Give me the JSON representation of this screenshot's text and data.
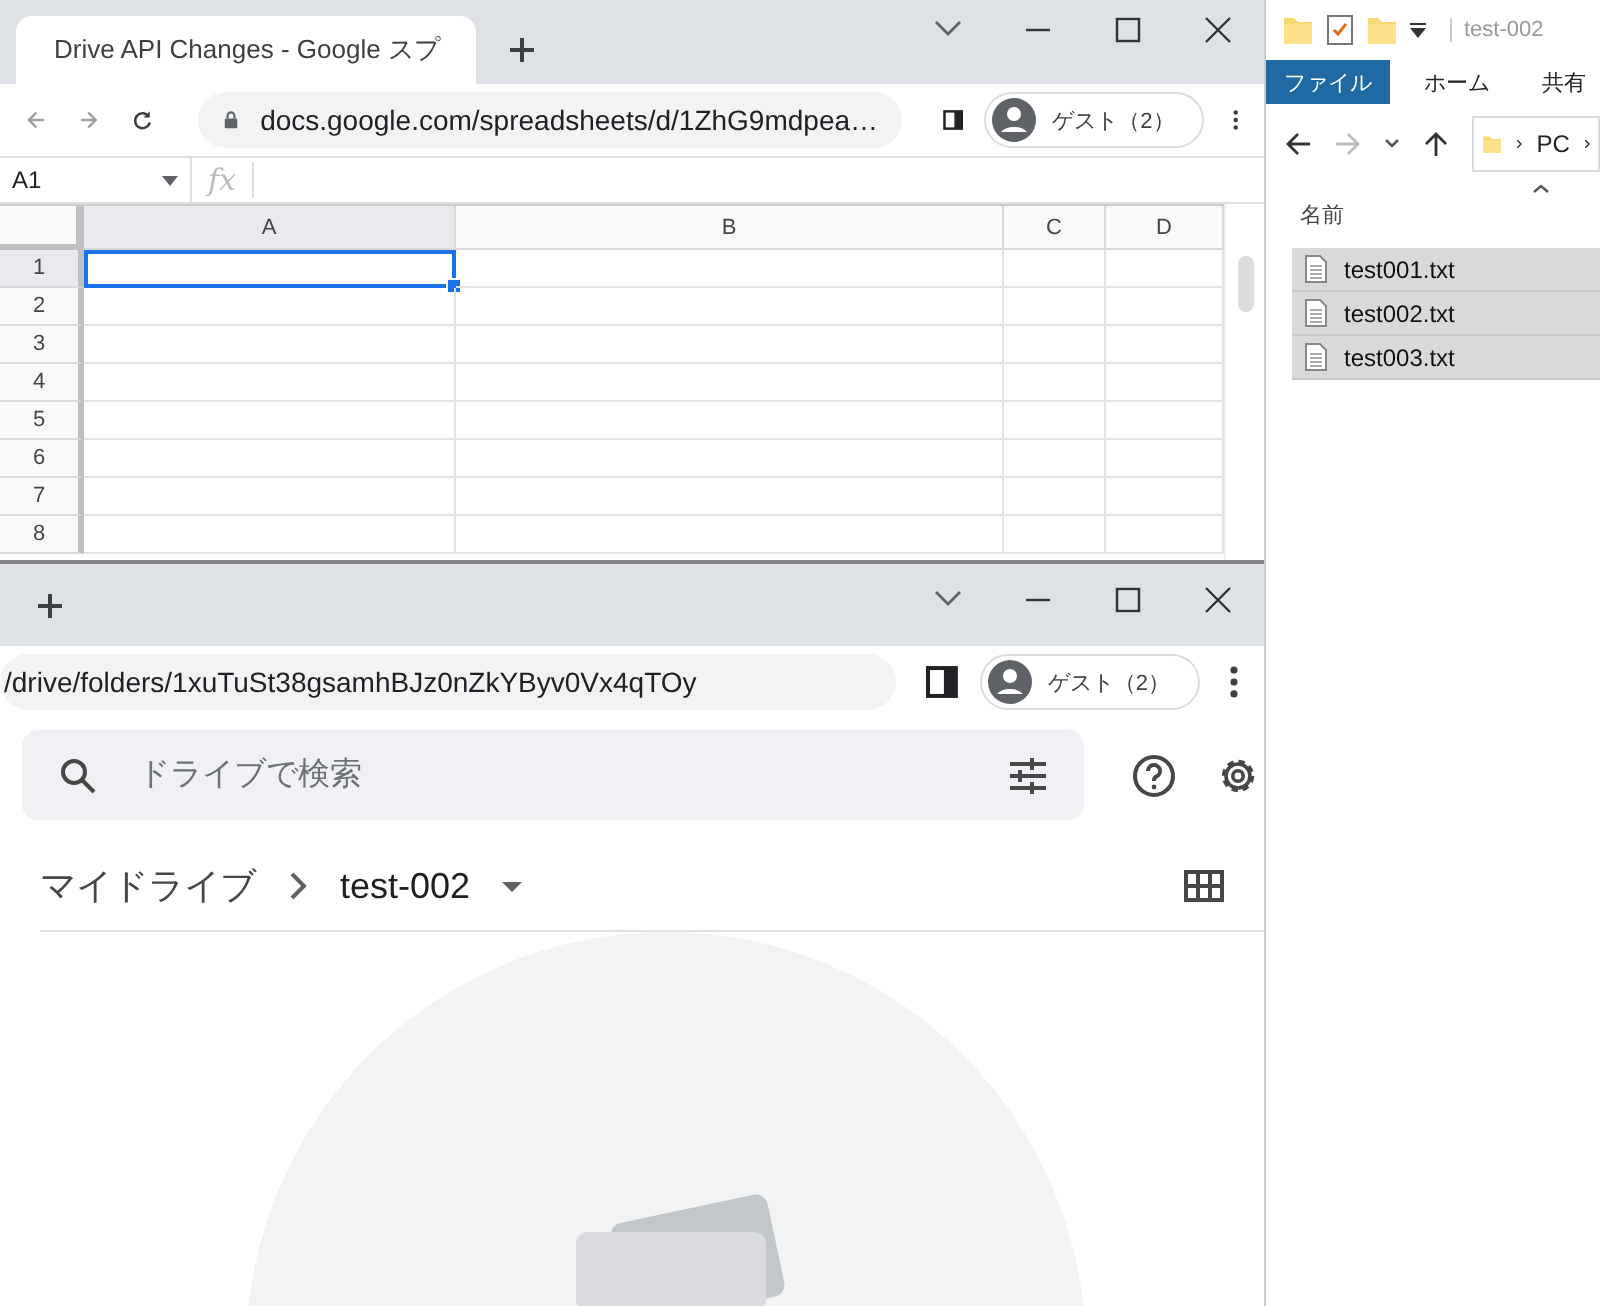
{
  "sheets_window": {
    "tab": {
      "title": "Drive API Changes - Google スプ",
      "selected": true
    },
    "address": "docs.google.com/spreadsheets/d/1ZhG9mdpea…",
    "profile": "ゲスト（2）",
    "name_box": "A1",
    "formula_label": "fx",
    "columns": [
      {
        "label": "A",
        "selected": true
      },
      {
        "label": "B",
        "selected": false
      },
      {
        "label": "C",
        "selected": false
      },
      {
        "label": "D",
        "selected": false
      }
    ],
    "rows": [
      {
        "label": "1",
        "selected": true
      },
      {
        "label": "2",
        "selected": false
      },
      {
        "label": "3",
        "selected": false
      },
      {
        "label": "4",
        "selected": false
      },
      {
        "label": "5",
        "selected": false
      },
      {
        "label": "6",
        "selected": false
      },
      {
        "label": "7",
        "selected": false
      },
      {
        "label": "8",
        "selected": false
      }
    ]
  },
  "drive_window": {
    "address": "/drive/folders/1xuTuSt38gsamhBJz0nZkYByv0Vx4qTOy",
    "profile": "ゲスト（2）",
    "search": {
      "placeholder": "ドライブで検索"
    },
    "breadcrumb": [
      "マイドライブ",
      "test-002"
    ]
  },
  "explorer_window": {
    "title": "test-002",
    "ribbon_tabs": [
      {
        "label": "ファイル",
        "selected": true
      },
      {
        "label": "ホーム",
        "selected": false
      },
      {
        "label": "共有",
        "selected": false
      }
    ],
    "path": [
      "PC"
    ],
    "column": "名前",
    "files": [
      {
        "name": "test001.txt",
        "selected": true
      },
      {
        "name": "test002.txt",
        "selected": true
      },
      {
        "name": "test003.txt",
        "selected": true
      }
    ]
  }
}
